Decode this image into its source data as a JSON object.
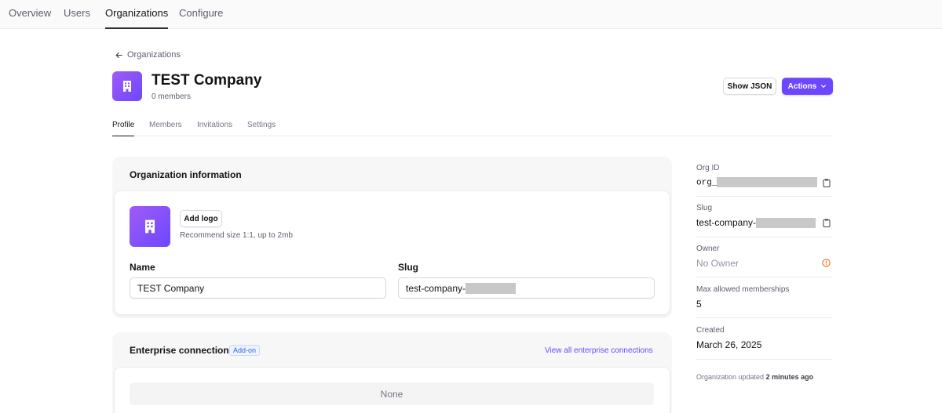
{
  "nav": {
    "tabs": [
      {
        "label": "Overview"
      },
      {
        "label": "Users"
      },
      {
        "label": "Organizations"
      },
      {
        "label": "Configure"
      }
    ]
  },
  "breadcrumb": {
    "label": "Organizations",
    "icon": "arrow-left-icon"
  },
  "header": {
    "title": "TEST Company",
    "subtitle": "0 members",
    "show_json_label": "Show JSON",
    "actions_label": "Actions"
  },
  "subtabs": [
    {
      "label": "Profile"
    },
    {
      "label": "Members"
    },
    {
      "label": "Invitations"
    },
    {
      "label": "Settings"
    }
  ],
  "org_info": {
    "title": "Organization information",
    "add_logo_label": "Add logo",
    "logo_hint": "Recommend size 1:1, up to 2mb",
    "name_label": "Name",
    "name_value": "TEST Company",
    "slug_label": "Slug",
    "slug_value": "test-company-"
  },
  "enterprise": {
    "title": "Enterprise connections",
    "badge": "Add-on",
    "link": "View all enterprise connections",
    "empty": "None"
  },
  "side": {
    "org_id_label": "Org ID",
    "org_id_value": "org_",
    "slug_label": "Slug",
    "slug_value": "test-company-",
    "owner_label": "Owner",
    "owner_value": "No Owner",
    "max_label": "Max allowed memberships",
    "max_value": "5",
    "created_label": "Created",
    "created_value": "March 26, 2025",
    "updated_prefix": "Organization updated",
    "updated_time": "2 minutes ago"
  },
  "colors": {
    "accent": "#6c47ff",
    "warning": "#f36b16",
    "avatar_gradient_start": "#9f5cf5"
  }
}
